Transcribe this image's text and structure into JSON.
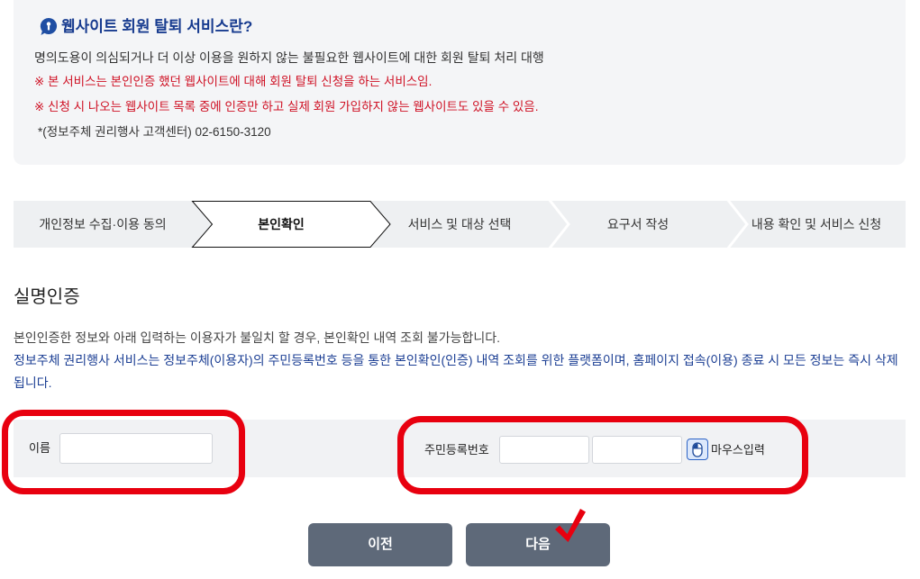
{
  "info": {
    "title": "웹사이트 회원 탈퇴 서비스란?",
    "description": "명의도용이 의심되거나 더 이상 이용을 원하지 않는 불필요한 웹사이트에 대한 회원 탈퇴 처리 대행",
    "notices": [
      "※ 본 서비스는 본인인증 했던 웹사이트에 대해 회원 탈퇴 신청을 하는 서비스임.",
      "※ 신청 시 나오는 웹사이트 목록 중에 인증만 하고 실제 회원 가입하지 않는 웹사이트도 있을 수 있음."
    ],
    "contact": "*(정보주체 권리행사 고객센터) 02-6150-3120"
  },
  "steps": {
    "current_index": 1,
    "items": [
      {
        "label": "개인정보 수집·이용 동의"
      },
      {
        "label": "본인확인"
      },
      {
        "label": "서비스 및 대상 선택"
      },
      {
        "label": "요구서 작성"
      },
      {
        "label": "내용 확인 및 서비스 신청"
      }
    ]
  },
  "section": {
    "title": "실명인증",
    "notice": "본인인증한 정보와 아래 입력하는 이용자가 불일치 할 경우, 본인확인 내역 조회 불가능합니다.",
    "info": "정보주체 권리행사 서비스는 정보주체(이용자)의 주민등록번호 등을 통한 본인확인(인증) 내역 조회를 위한 플랫폼이며, 홈페이지 접속(이용) 종료 시 모든 정보는 즉시 삭제됩니다."
  },
  "form": {
    "name": {
      "label": "이름",
      "value": ""
    },
    "rrn": {
      "label": "주민등록번호",
      "front_value": "",
      "back_value": ""
    },
    "mouse_input": {
      "label": "마우스입력"
    }
  },
  "buttons": {
    "prev": "이전",
    "next": "다음"
  },
  "icons": {
    "info": "info-bubble-icon",
    "mouse_input": "mouse-icon",
    "annotation": "checkmark-icon"
  },
  "colors": {
    "title_blue": "#173b8f",
    "accent_blue": "#1c3f94",
    "notice_red": "#cf1124",
    "button_gray": "#5e6979",
    "annotation_red": "#e8000f"
  }
}
